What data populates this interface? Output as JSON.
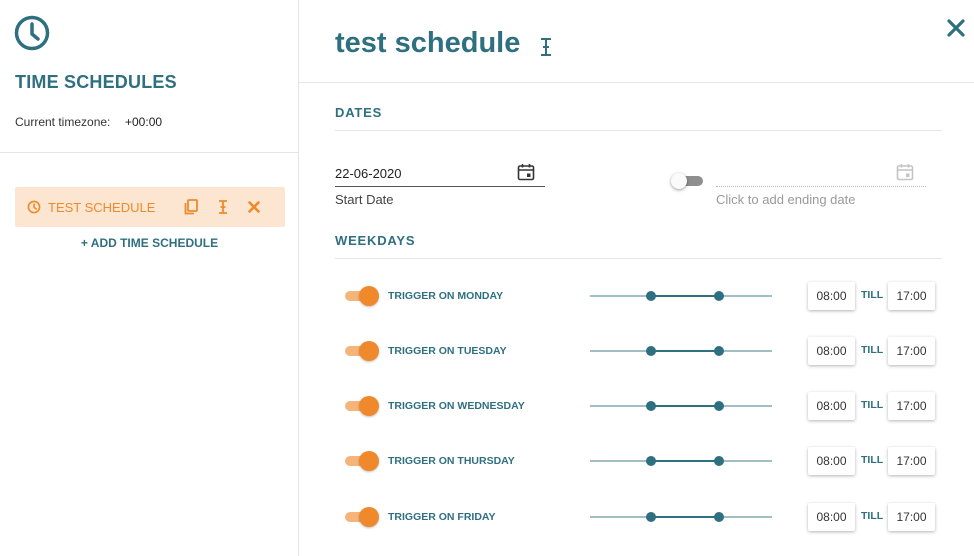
{
  "sidebar": {
    "title": "TIME SCHEDULES",
    "timezone_label": "Current timezone:",
    "timezone_value": "+00:00",
    "schedules": [
      {
        "label": "TEST SCHEDULE",
        "icon": "clock-icon",
        "actions": [
          "copy-icon",
          "rename-icon",
          "delete-icon"
        ]
      }
    ],
    "add_label": "+ ADD TIME SCHEDULE"
  },
  "main": {
    "title": "test schedule",
    "dates": {
      "section_title": "DATES",
      "start_date": "22-06-2020",
      "start_caption": "Start Date",
      "end_enabled": false,
      "end_placeholder": "Click to add ending date"
    },
    "weekdays": {
      "section_title": "WEEKDAYS",
      "till_label": "TILL",
      "slider_max_hours": 24,
      "rows": [
        {
          "label": "TRIGGER ON MONDAY",
          "enabled": true,
          "start": "08:00",
          "end": "17:00"
        },
        {
          "label": "TRIGGER ON TUESDAY",
          "enabled": true,
          "start": "08:00",
          "end": "17:00"
        },
        {
          "label": "TRIGGER ON WEDNESDAY",
          "enabled": true,
          "start": "08:00",
          "end": "17:00"
        },
        {
          "label": "TRIGGER ON THURSDAY",
          "enabled": true,
          "start": "08:00",
          "end": "17:00"
        },
        {
          "label": "TRIGGER ON FRIDAY",
          "enabled": true,
          "start": "08:00",
          "end": "17:00"
        }
      ]
    }
  },
  "colors": {
    "primary": "#2f7080",
    "accent": "#f0892b",
    "accent_light": "#fde6d1"
  }
}
